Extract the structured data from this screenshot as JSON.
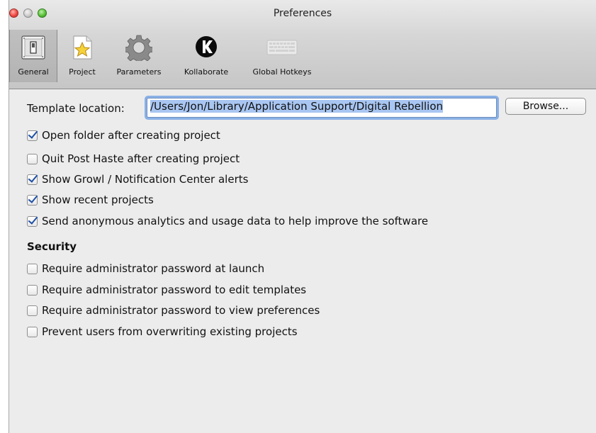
{
  "window": {
    "title": "Preferences"
  },
  "toolbar": {
    "items": [
      {
        "label": "General",
        "icon": "switch-icon"
      },
      {
        "label": "Project",
        "icon": "star-document-icon"
      },
      {
        "label": "Parameters",
        "icon": "gear-icon"
      },
      {
        "label": "Kollaborate",
        "icon": "kollaborate-logo-icon"
      },
      {
        "label": "Global Hotkeys",
        "icon": "keyboard-icon"
      }
    ],
    "selected": "General"
  },
  "general": {
    "template_label": "Template location:",
    "template_value": "/Users/Jon/Library/Application Support/Digital Rebellion",
    "browse_label": "Browse...",
    "options": [
      {
        "label": "Open folder after creating project",
        "checked": true
      },
      {
        "label": "Quit Post Haste after creating project",
        "checked": false
      },
      {
        "label": "Show Growl / Notification Center alerts",
        "checked": true
      },
      {
        "label": "Show recent projects",
        "checked": true
      },
      {
        "label": "Send anonymous analytics and usage data to help improve the software",
        "checked": true
      }
    ],
    "security_heading": "Security",
    "security_options": [
      {
        "label": "Require administrator password at launch",
        "checked": false
      },
      {
        "label": "Require administrator password to edit templates",
        "checked": false
      },
      {
        "label": "Require administrator password to view preferences",
        "checked": false
      },
      {
        "label": "Prevent users from overwriting existing projects",
        "checked": false
      }
    ]
  },
  "colors": {
    "accent": "#1e4fa6",
    "focus_ring": "#8ab1e6"
  }
}
